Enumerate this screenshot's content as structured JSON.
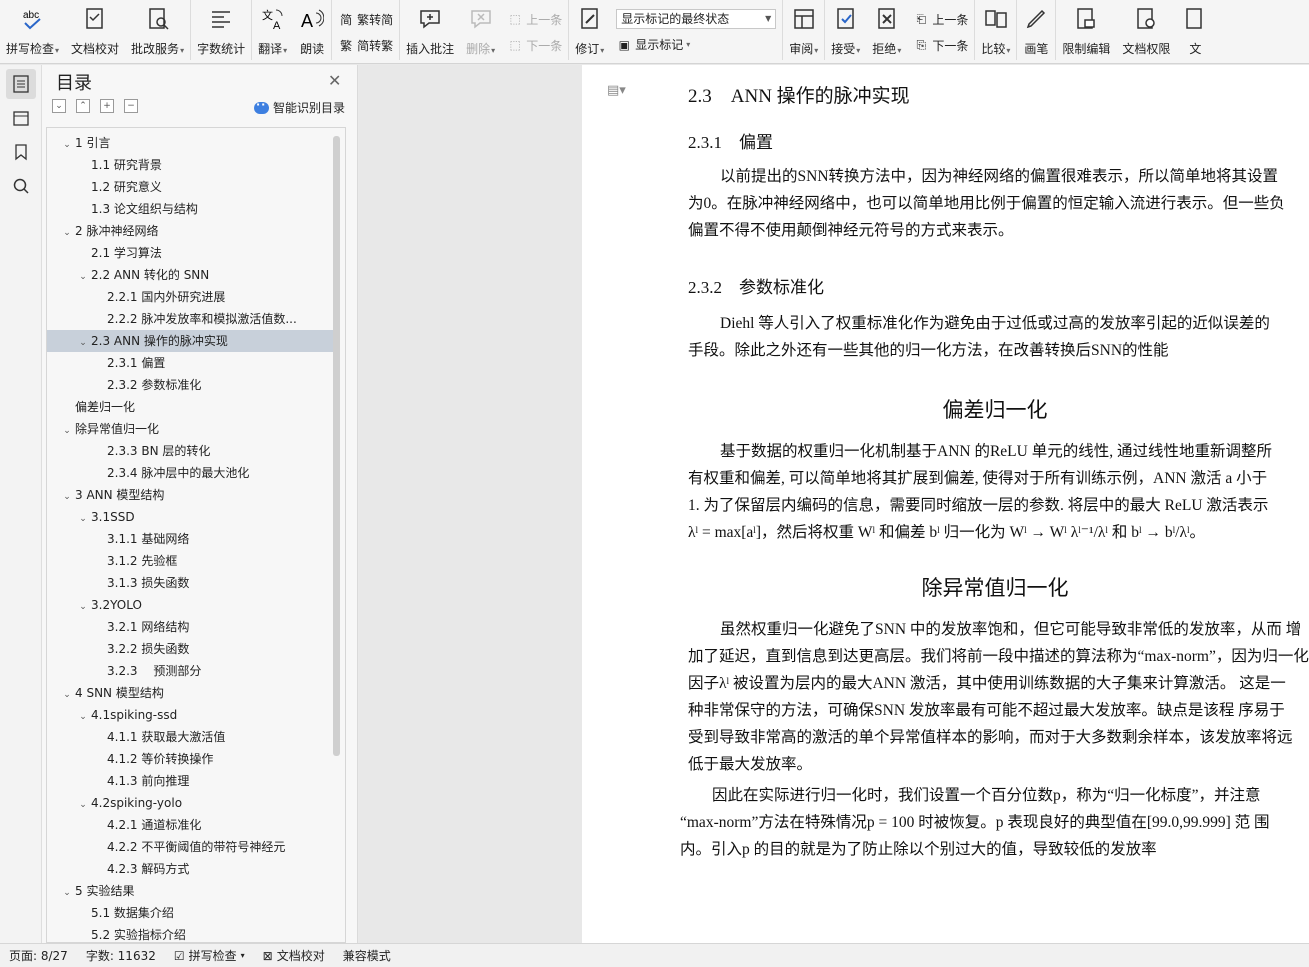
{
  "ribbon": {
    "buttons_a": [
      {
        "label": "拼写检查",
        "icon": "spellcheck-icon",
        "arrow": true
      },
      {
        "label": "文档校对",
        "icon": "doc-proof-icon",
        "arrow": false
      },
      {
        "label": "批改服务",
        "icon": "correction-icon",
        "arrow": true
      },
      {
        "label": "字数统计",
        "icon": "wordcount-icon",
        "arrow": false
      },
      {
        "label": "翻译",
        "icon": "translate-icon",
        "arrow": true
      },
      {
        "label": "朗读",
        "icon": "read-aloud-icon",
        "arrow": false
      }
    ],
    "trad_simp": {
      "to_trad": "繁转简",
      "to_simp": "简转繁"
    },
    "comment": {
      "insert": "插入批注",
      "delete": "删除",
      "prev": "上一条",
      "next": "下一条"
    },
    "revise": {
      "label": "修订",
      "markup_select": "显示标记的最终状态",
      "show_markup": "显示标记"
    },
    "review": {
      "review": "审阅",
      "accept": "接受",
      "reject": "拒绝",
      "prev": "上一条",
      "next": "下一条"
    },
    "buttons_b": [
      {
        "label": "比较",
        "icon": "compare-icon",
        "arrow": true
      },
      {
        "label": "画笔",
        "icon": "pen-icon",
        "arrow": false
      },
      {
        "label": "限制编辑",
        "icon": "restrict-edit-icon",
        "arrow": false
      },
      {
        "label": "文档权限",
        "icon": "doc-permission-icon",
        "arrow": false
      },
      {
        "label": "文",
        "icon": "doc-more-icon",
        "arrow": false
      }
    ]
  },
  "toc": {
    "title": "目录",
    "smart_label": "智能识别目录",
    "items": [
      {
        "text": "1 引言",
        "level": 1,
        "toggle": "expanded"
      },
      {
        "text": "1.1 研究背景",
        "level": 2,
        "toggle": ""
      },
      {
        "text": "1.2 研究意义",
        "level": 2,
        "toggle": ""
      },
      {
        "text": "1.3 论文组织与结构",
        "level": 2,
        "toggle": ""
      },
      {
        "text": "2 脉冲神经网络",
        "level": 1,
        "toggle": "expanded"
      },
      {
        "text": "2.1 学习算法",
        "level": 2,
        "toggle": ""
      },
      {
        "text": "2.2 ANN 转化的 SNN",
        "level": 2,
        "toggle": "expanded"
      },
      {
        "text": "2.2.1 国内外研究进展",
        "level": 3,
        "toggle": ""
      },
      {
        "text": "2.2.2 脉冲发放率和模拟激活值数...",
        "level": 3,
        "toggle": ""
      },
      {
        "text": "2.3 ANN 操作的脉冲实现",
        "level": 2,
        "toggle": "expanded",
        "active": true
      },
      {
        "text": "2.3.1 偏置",
        "level": 3,
        "toggle": ""
      },
      {
        "text": "2.3.2 参数标准化",
        "level": 3,
        "toggle": ""
      },
      {
        "text": "偏差归一化",
        "level": 1,
        "toggle": ""
      },
      {
        "text": "除异常值归一化",
        "level": 1,
        "toggle": "expanded"
      },
      {
        "text": "2.3.3 BN 层的转化",
        "level": 3,
        "toggle": ""
      },
      {
        "text": "2.3.4 脉冲层中的最大池化",
        "level": 3,
        "toggle": ""
      },
      {
        "text": "3 ANN 模型结构",
        "level": 1,
        "toggle": "expanded"
      },
      {
        "text": "3.1SSD",
        "level": 2,
        "toggle": "expanded"
      },
      {
        "text": "3.1.1 基础网络",
        "level": 3,
        "toggle": ""
      },
      {
        "text": "3.1.2 先验框",
        "level": 3,
        "toggle": ""
      },
      {
        "text": "3.1.3 损失函数",
        "level": 3,
        "toggle": ""
      },
      {
        "text": "3.2YOLO",
        "level": 2,
        "toggle": "expanded"
      },
      {
        "text": "3.2.1 网络结构",
        "level": 3,
        "toggle": ""
      },
      {
        "text": "3.2.2 损失函数",
        "level": 3,
        "toggle": ""
      },
      {
        "text": "3.2.3　 预测部分",
        "level": 3,
        "toggle": ""
      },
      {
        "text": "4 SNN 模型结构",
        "level": 1,
        "toggle": "expanded"
      },
      {
        "text": "4.1spiking-ssd",
        "level": 2,
        "toggle": "expanded"
      },
      {
        "text": "4.1.1 获取最大激活值",
        "level": 3,
        "toggle": ""
      },
      {
        "text": "4.1.2 等价转换操作",
        "level": 3,
        "toggle": ""
      },
      {
        "text": "4.1.3 前向推理",
        "level": 3,
        "toggle": ""
      },
      {
        "text": "4.2spiking-yolo",
        "level": 2,
        "toggle": "expanded"
      },
      {
        "text": "4.2.1 通道标准化",
        "level": 3,
        "toggle": ""
      },
      {
        "text": "4.2.2 不平衡阈值的带符号神经元",
        "level": 3,
        "toggle": ""
      },
      {
        "text": "4.2.3 解码方式",
        "level": 3,
        "toggle": ""
      },
      {
        "text": "5 实验结果",
        "level": 1,
        "toggle": "expanded"
      },
      {
        "text": "5.1 数据集介绍",
        "level": 2,
        "toggle": ""
      },
      {
        "text": "5.2 实验指标介绍",
        "level": 2,
        "toggle": ""
      }
    ]
  },
  "doc": {
    "h_2_3": "2.3　ANN 操作的脉冲实现",
    "h_2_3_1": "2.3.1　偏置",
    "p1": [
      "以前提出的SNN转换方法中，因为神经网络的偏置很难表示，所以简单地将其设置",
      "为0。在脉冲神经网络中，也可以简单地用比例于偏置的恒定输入流进行表示。但一些负",
      "偏置不得不使用颠倒神经元符号的方式来表示。"
    ],
    "h_2_3_2": "2.3.2　参数标准化",
    "p2": [
      "Diehl 等人引入了权重标准化作为避免由于过低或过高的发放率引起的近似误差的",
      "手段。除此之外还有一些其他的归一化方法，在改善转换后SNN的性能"
    ],
    "h_bias_norm": "偏差归一化",
    "p3": [
      "基于数据的权重归一化机制基于ANN 的ReLU 单元的线性, 通过线性地重新调整所",
      "有权重和偏差, 可以简单地将其扩展到偏差, 使得对于所有训练示例，ANN 激活 a 小于",
      "1. 为了保留层内编码的信息，需要同时缩放一层的参数. 将层中的最大 ReLU 激活表示",
      "λˡ = max[aˡ]，然后将权重 Wˡ 和偏差 bˡ 归一化为 Wˡ → Wˡ λˡ⁻¹/λˡ 和 bˡ → bˡ/λˡ。"
    ],
    "h_outlier_norm": "除异常值归一化",
    "p4": [
      "虽然权重归一化避免了SNN 中的发放率饱和，但它可能导致非常低的发放率，从而 增",
      "加了延迟，直到信息到达更高层。我们将前一段中描述的算法称为“max-norm”，因为归一化",
      "因子λˡ 被设置为层内的最大ANN 激活，其中使用训练数据的大子集来计算激活。 这是一",
      "种非常保守的方法，可确保SNN 发放率最有可能不超过最大发放率。缺点是该程 序易于",
      "受到导致非常高的激活的单个异常值样本的影响，而对于大多数剩余样本，该发放率将远",
      "低于最大发放率。"
    ],
    "p5": [
      "因此在实际进行归一化时，我们设置一个百分位数p，称为“归一化标度”，并注意",
      "“max-norm”方法在特殊情况p = 100 时被恢复。p 表现良好的典型值在[99.0,99.999] 范 围",
      "内。引入p 的目的就是为了防止除以个别过大的值，导致较低的发放率"
    ]
  },
  "status": {
    "page": "页面: 8/27",
    "words": "字数: 11632",
    "spell": "拼写检查",
    "proof": "文档校对",
    "compat": "兼容模式"
  }
}
